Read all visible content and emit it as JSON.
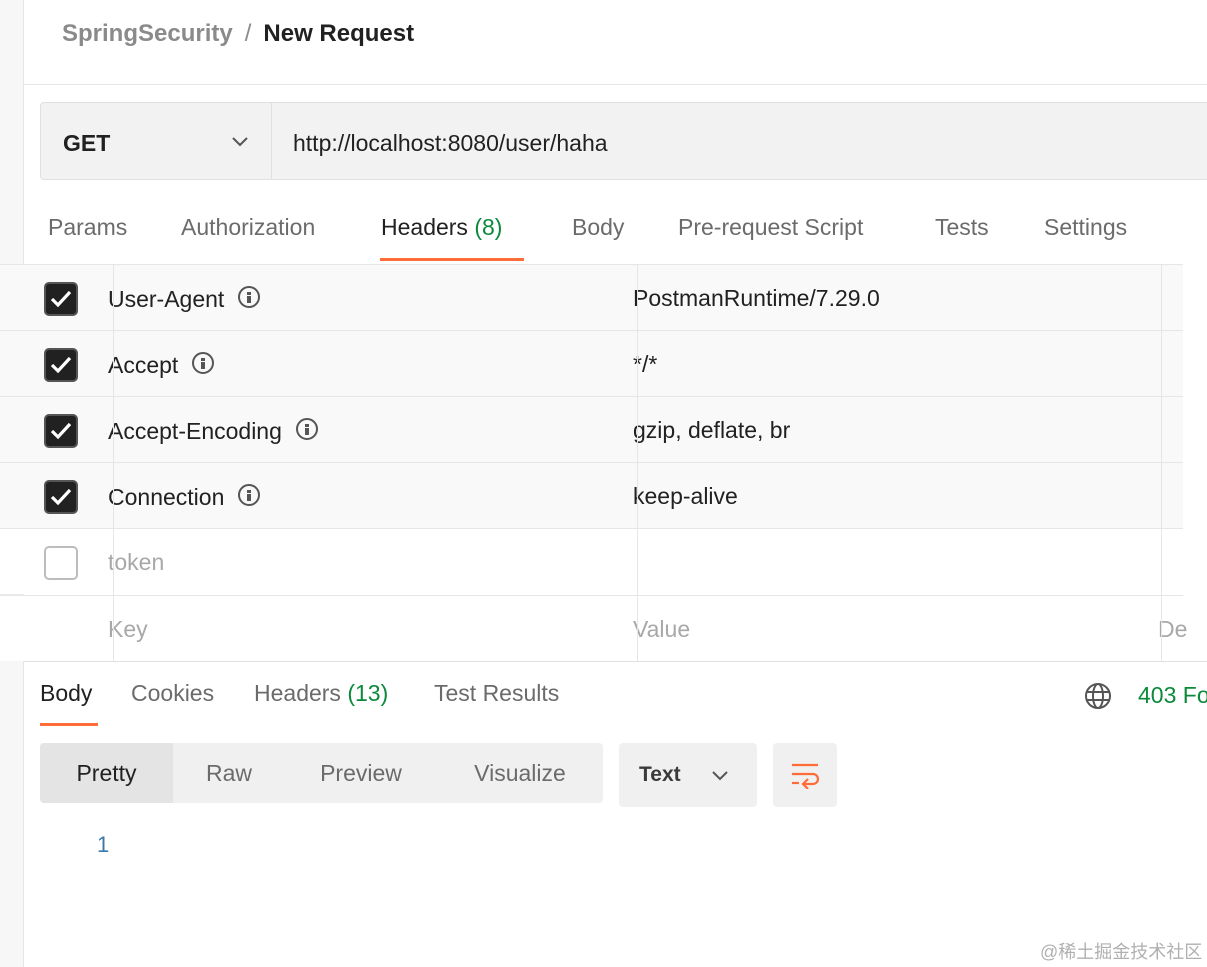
{
  "breadcrumb": {
    "parent": "SpringSecurity",
    "separator": "/",
    "current": "New Request"
  },
  "request": {
    "method": "GET",
    "url": "http://localhost:8080/user/haha"
  },
  "request_tabs": [
    {
      "label": "Params"
    },
    {
      "label": "Authorization"
    },
    {
      "label": "Headers",
      "count": "(8)",
      "active": true
    },
    {
      "label": "Body"
    },
    {
      "label": "Pre-request Script"
    },
    {
      "label": "Tests"
    },
    {
      "label": "Settings"
    }
  ],
  "headers": {
    "rows": [
      {
        "key": "User-Agent",
        "value": "PostmanRuntime/7.29.0",
        "checked": true
      },
      {
        "key": "Accept",
        "value": "*/*",
        "checked": true
      },
      {
        "key": "Accept-Encoding",
        "value": "gzip, deflate, br",
        "checked": true
      },
      {
        "key": "Connection",
        "value": "keep-alive",
        "checked": true
      },
      {
        "key": "token",
        "value": "",
        "checked": false
      }
    ],
    "placeholder": {
      "key": "Key",
      "value": "Value",
      "description": "De"
    }
  },
  "response": {
    "tabs": [
      {
        "label": "Body",
        "active": true
      },
      {
        "label": "Cookies"
      },
      {
        "label": "Headers",
        "count": "(13)"
      },
      {
        "label": "Test Results"
      }
    ],
    "status": "403 Fo",
    "view_modes": [
      "Pretty",
      "Raw",
      "Preview",
      "Visualize"
    ],
    "active_view": "Pretty",
    "format": "Text",
    "line_number": "1"
  },
  "watermark": "@稀土掘金技术社区",
  "colors": {
    "accent": "#ff6c37",
    "success": "#0b8a3c",
    "line_number": "#3c78a8"
  },
  "icons": [
    "chevron-down-icon",
    "info-icon",
    "checkbox-checked-icon",
    "globe-icon",
    "wrap-lines-icon"
  ]
}
